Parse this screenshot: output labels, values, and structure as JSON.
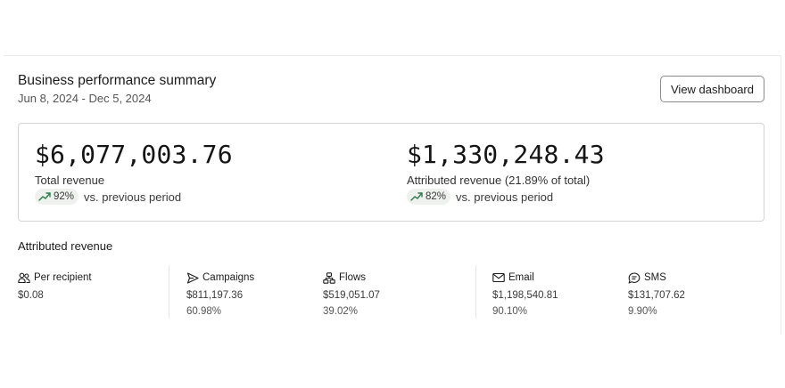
{
  "header": {
    "title": "Business performance summary",
    "date_range": "Jun 8, 2024 - Dec 5, 2024",
    "view_dashboard_label": "View dashboard"
  },
  "summary": {
    "total": {
      "amount": "$6,077,003.76",
      "label": "Total revenue",
      "change": "92%",
      "comparison": "vs. previous period"
    },
    "attributed": {
      "amount": "$1,330,248.43",
      "label": "Attributed revenue (21.89% of total)",
      "change": "82%",
      "comparison": "vs. previous period"
    }
  },
  "attributed_section": {
    "title": "Attributed revenue",
    "stats": [
      {
        "icon": "people-icon",
        "label": "Per recipient",
        "value": "$0.08",
        "percent": ""
      },
      {
        "icon": "send-icon",
        "label": "Campaigns",
        "value": "$811,197.36",
        "percent": "60.98%"
      },
      {
        "icon": "flows-icon",
        "label": "Flows",
        "value": "$519,051.07",
        "percent": "39.02%"
      },
      {
        "icon": "email-icon",
        "label": "Email",
        "value": "$1,198,540.81",
        "percent": "90.10%"
      },
      {
        "icon": "sms-icon",
        "label": "SMS",
        "value": "$131,707.62",
        "percent": "9.90%"
      }
    ]
  },
  "colors": {
    "trend_up": "#2f7d4f",
    "pill_bg": "#eef1ee",
    "border": "#d4d4d4"
  }
}
